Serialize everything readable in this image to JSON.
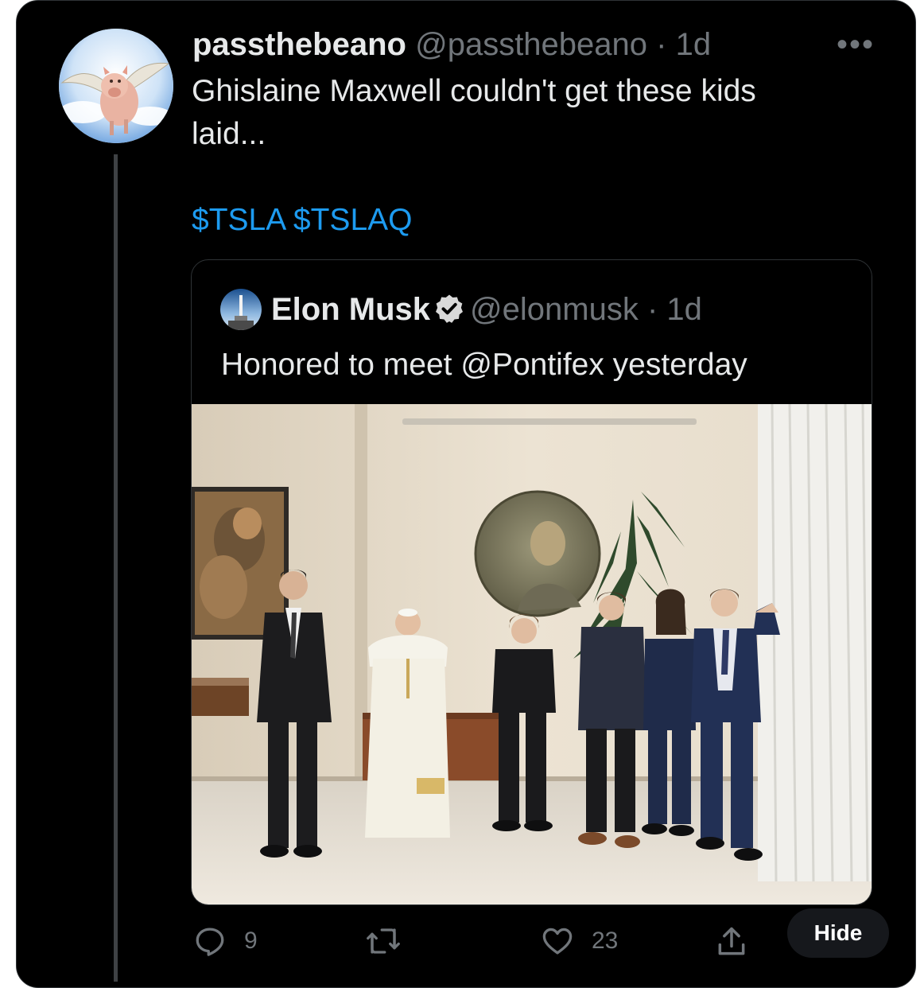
{
  "tweet": {
    "display_name": "passthebeano",
    "handle": "@passthebeano",
    "separator": "·",
    "time": "1d",
    "more_label": "•••",
    "text_line1": "Ghislaine Maxwell couldn't get these kids",
    "text_line2": "laid...",
    "cashtag1": "$TSLA",
    "cashtag2": "$TSLAQ",
    "avatar_icon": "flying-pig-avatar"
  },
  "quote": {
    "display_name": "Elon Musk",
    "verified_icon": "verified-badge-icon",
    "handle": "@elonmusk",
    "separator": "·",
    "time": "1d",
    "text": "Honored to meet @Pontifex yesterday",
    "avatar_icon": "rocket-launch-avatar",
    "photo_icon": "group-photo-with-pope"
  },
  "actions": {
    "reply_count": "9",
    "retweet_count": "",
    "like_count": "23",
    "hide_label": "Hide"
  },
  "colors": {
    "background": "#000000",
    "text": "#e7e9ea",
    "muted": "#71767b",
    "link": "#1d9bf0",
    "border": "#2f3336"
  }
}
